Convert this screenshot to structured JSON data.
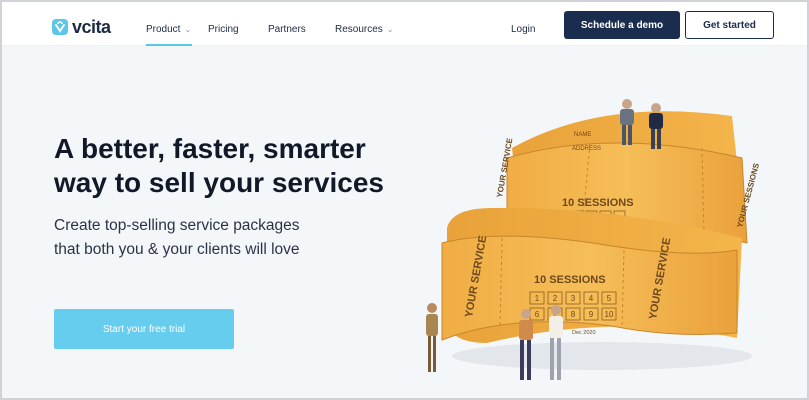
{
  "brand": {
    "name": "vcita",
    "accent": "#5bc6e8",
    "navy": "#1b2d4f",
    "cta": "#66cdee"
  },
  "nav": {
    "items": [
      {
        "label": "Product",
        "has_dropdown": true,
        "active": true
      },
      {
        "label": "Pricing",
        "has_dropdown": false
      },
      {
        "label": "Partners",
        "has_dropdown": false
      },
      {
        "label": "Resources",
        "has_dropdown": true
      }
    ],
    "login": "Login",
    "schedule_demo": "Schedule a demo",
    "get_started": "Get started"
  },
  "hero": {
    "title_line1": "A better, faster, smarter",
    "title_line2": "way to sell your services",
    "subtitle_line1": "Create top-selling service packages",
    "subtitle_line2": "that both you & your clients will love",
    "cta": "Start your free trial"
  },
  "illustration": {
    "ticket_upper_heading": "10 SESSIONS",
    "ticket_lower_heading": "10 SESSIONS",
    "stub_text": "YOUR SERVICE",
    "side_text": "YOUR SESSIONS",
    "name_label": "NAME",
    "address_label": "ADDRESS",
    "date_text": "Dec 2020",
    "session_numbers": [
      "1",
      "2",
      "3",
      "4",
      "5",
      "6",
      "7",
      "8",
      "9",
      "10"
    ]
  }
}
